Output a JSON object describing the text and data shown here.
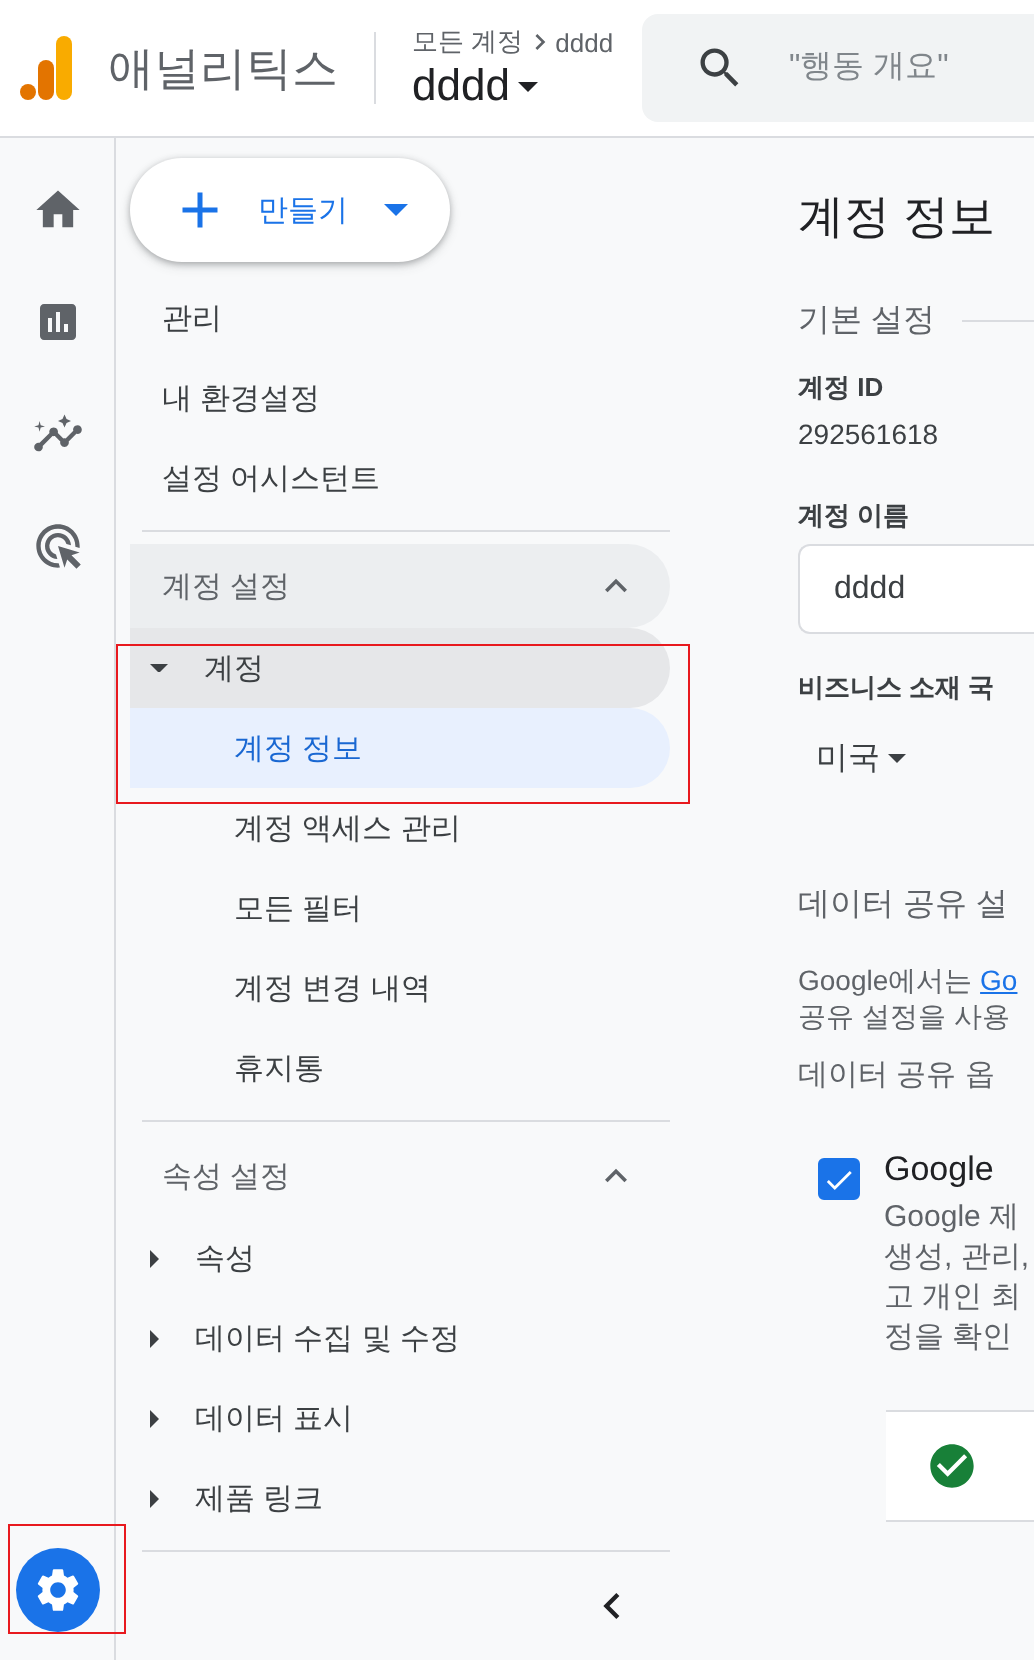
{
  "header": {
    "product": "애널리틱스",
    "breadcrumb": [
      "모든 계정",
      "dddd"
    ],
    "account": "dddd",
    "search": {
      "placeholder": "\"행동 개요\""
    }
  },
  "rail": [
    {
      "kind": "home",
      "selected": false
    },
    {
      "kind": "reports",
      "selected": false
    },
    {
      "kind": "explore",
      "selected": false
    },
    {
      "kind": "advertising",
      "selected": false
    },
    {
      "kind": "admin",
      "selected": true
    }
  ],
  "create_button": "만들기",
  "nav": {
    "top_items": [
      "관리",
      "내 환경설정",
      "설정 어시스턴트"
    ],
    "sections": [
      {
        "title": "계정 설정",
        "expanded": true,
        "groups": [
          {
            "label": "계정",
            "expanded": true,
            "children": [
              {
                "label": "계정 정보",
                "selected": true
              },
              {
                "label": "계정 액세스 관리",
                "selected": false
              },
              {
                "label": "모든 필터",
                "selected": false
              },
              {
                "label": "계정 변경 내역",
                "selected": false
              },
              {
                "label": "휴지통",
                "selected": false
              }
            ]
          }
        ]
      },
      {
        "title": "속성 설정",
        "expanded": true,
        "groups": [
          {
            "label": "속성",
            "expanded": false
          },
          {
            "label": "데이터 수집 및 수정",
            "expanded": false
          },
          {
            "label": "데이터 표시",
            "expanded": false
          },
          {
            "label": "제품 링크",
            "expanded": false
          }
        ]
      }
    ]
  },
  "content": {
    "title": "계정 정보",
    "basic_heading": "기본 설정",
    "account_id_label": "계정 ID",
    "account_id": "292561618",
    "account_name_label": "계정 이름",
    "account_name": "dddd",
    "country_label": "비즈니스 소재 국",
    "country": "미국",
    "sharing_heading": "데이터 공유 설",
    "sharing_text": "Google에서는 ",
    "sharing_link": "Go",
    "sharing_text_2": "공유 설정을 사용",
    "options_heading": "데이터 공유 옵",
    "option": {
      "checked": true,
      "title": "Google",
      "description": [
        "Google 제",
        "생성, 관리,",
        "고 개인 최",
        "정을 확인"
      ]
    }
  }
}
